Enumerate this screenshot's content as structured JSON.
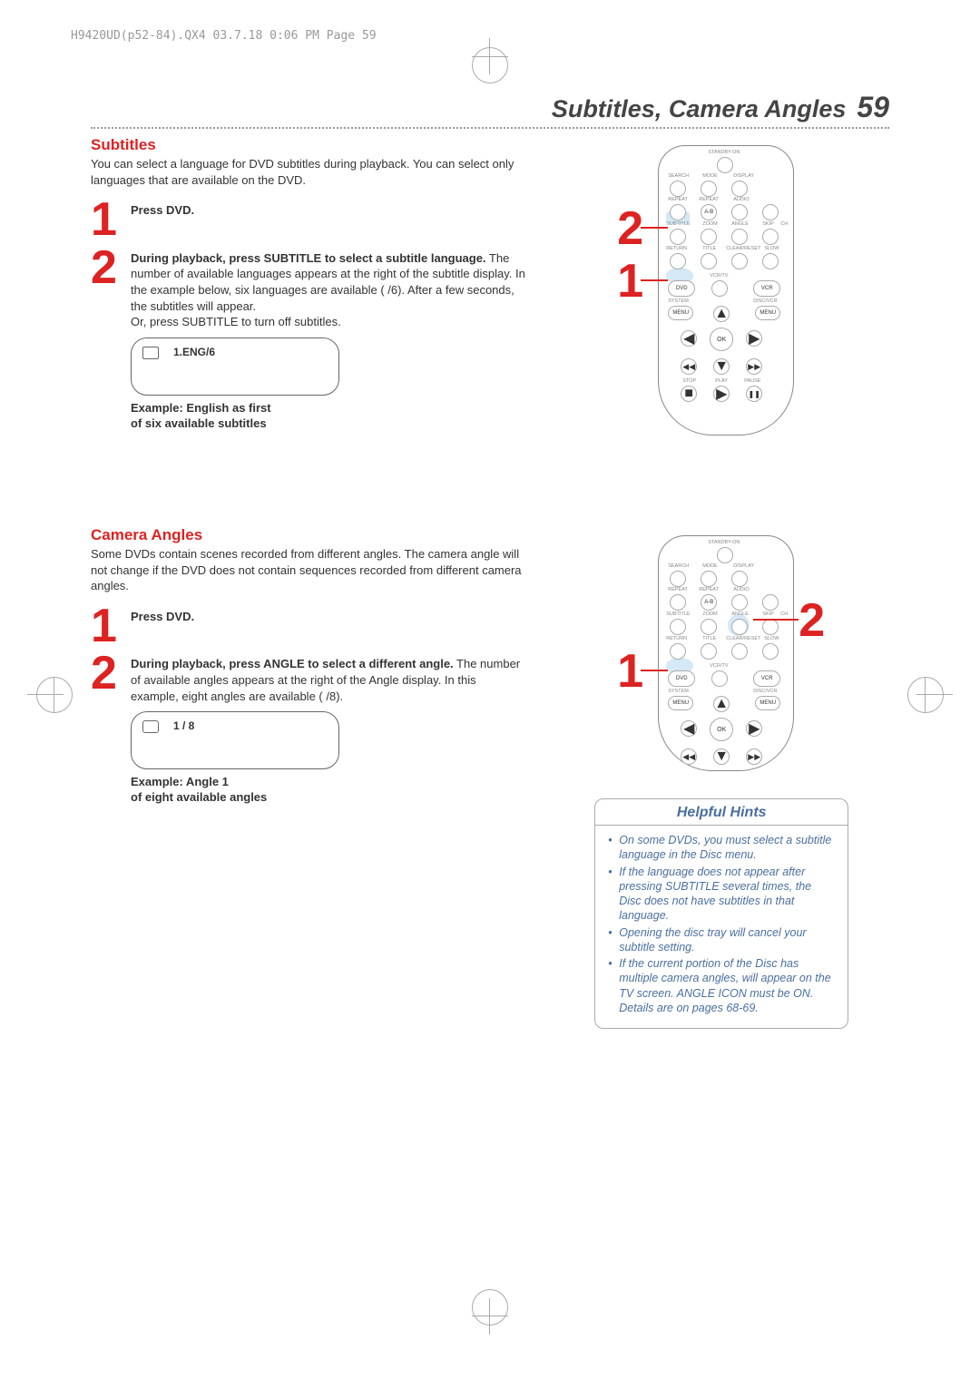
{
  "header_meta": "H9420UD(p52-84).QX4  03.7.18  0:06 PM  Page 59",
  "page_title": "Subtitles, Camera Angles",
  "page_number": "59",
  "subtitles": {
    "title": "Subtitles",
    "intro": "You can select a language for DVD subtitles during playback. You can select only languages that are available on the DVD.",
    "step1": "Press DVD.",
    "step2_bold": "During playback, press SUBTITLE to select a subtitle language.",
    "step2_rest": " The number of available languages appears at the right of the subtitle display. In the example below, six languages are available (   /6). After a few seconds, the subtitles will appear.",
    "step2_line2": "Or, press SUBTITLE to turn off subtitles.",
    "display_value": "1.ENG/6",
    "example_caption": "Example: English as first\nof six available subtitles"
  },
  "angles": {
    "title": "Camera Angles",
    "intro": "Some DVDs contain scenes recorded from different angles. The camera angle will not change if the DVD does not contain sequences recorded from different camera angles.",
    "step1": "Press DVD.",
    "step2_bold": "During playback, press ANGLE to select a different angle.",
    "step2_rest": " The number of available angles appears at the right of the Angle display. In this example, eight angles are available (   /8).",
    "display_value": "1 / 8",
    "example_caption": "Example: Angle 1\nof eight available angles"
  },
  "hints": {
    "title": "Helpful Hints",
    "items": [
      "On some DVDs, you must select a subtitle language in the Disc menu.",
      "If the language does not appear after pressing SUBTITLE several times, the Disc does not have subtitles in that language.",
      "Opening the disc tray will cancel your subtitle setting.",
      "If the current portion of the Disc has multiple camera angles,     will appear on the TV screen. ANGLE ICON must be ON. Details are on pages 68-69."
    ]
  },
  "remote_labels": {
    "standby": "STANDBY-ON",
    "search": "SEARCH",
    "mode": "MODE",
    "display": "DISPLAY",
    "repeat": "REPEAT",
    "repeat2": "REPEAT",
    "audio": "AUDIO",
    "ab": "A-B",
    "subtitle": "SUBTITLE",
    "zoom": "ZOOM",
    "angle": "ANGLE",
    "skip": "SKIP",
    "ch": "CH",
    "return": "RETURN",
    "title": "TITLE",
    "clear": "CLEAR/RESET",
    "slow": "SLOW",
    "vcrtv": "VCR/TV",
    "dvd": "DVD",
    "vcr": "VCR",
    "system": "SYSTEM",
    "discvcr": "DISC/VCR",
    "menu": "MENU",
    "menu2": "MENU",
    "ok": "OK",
    "stop": "STOP",
    "play": "PLAY",
    "pause": "PAUSE"
  }
}
